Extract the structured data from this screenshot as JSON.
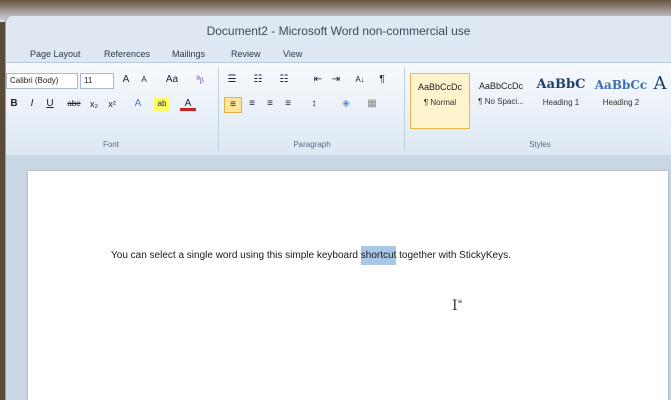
{
  "window": {
    "title": "Document2 - Microsoft Word non-commercial use"
  },
  "tabs": [
    "Page Layout",
    "References",
    "Mailings",
    "Review",
    "View"
  ],
  "font_group": {
    "font_name": "Calibri (Body)",
    "font_size": "11",
    "grow": "A",
    "shrink": "A",
    "change_case": "Aa",
    "clear_format": "ᵃᵦ",
    "bold": "B",
    "italic": "I",
    "underline": "U",
    "strikethrough": "abe",
    "subscript": "x₂",
    "superscript": "x²",
    "text_effects": "A",
    "highlight": "ab",
    "font_color": "A",
    "label": "Font"
  },
  "paragraph_group": {
    "bullets": "☰",
    "numbering": "☷",
    "multilevel": "☷",
    "decrease_indent": "⇤",
    "increase_indent": "⇥",
    "sort": "A↓",
    "show_marks": "¶",
    "align_left": "≡",
    "center": "≡",
    "align_right": "≡",
    "justify": "≡",
    "line_spacing": "↕",
    "shading": "◈",
    "borders": "▦",
    "label": "Paragraph"
  },
  "styles_group": {
    "items": [
      {
        "preview": "AaBbCcDc",
        "name": "¶ Normal"
      },
      {
        "preview": "AaBbCcDc",
        "name": "¶ No Spaci..."
      },
      {
        "preview": "AaBbC",
        "name": "Heading 1"
      },
      {
        "preview": "AaBbCc",
        "name": "Heading 2"
      },
      {
        "preview": "A",
        "name": ""
      }
    ],
    "label": "Styles"
  },
  "document": {
    "before": "You can select a single word using this simple keyboard ",
    "selected": "shortcut",
    "after": " together with StickyKeys."
  },
  "cursor": {
    "glyph": "I",
    "badge": "≡"
  },
  "colors": {
    "highlight": "#a9c7e6",
    "accent": "#fde59a"
  }
}
